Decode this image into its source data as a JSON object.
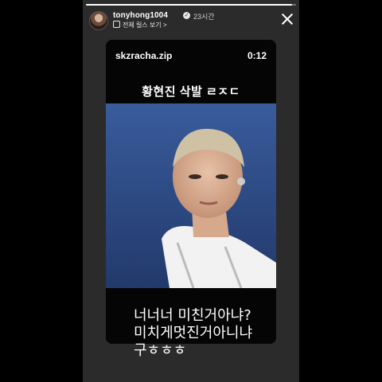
{
  "progress_fraction": 0.98,
  "header": {
    "username": "tonyhong1004",
    "time": "23시간",
    "reels_link": "전체 릴스 보기 >"
  },
  "card": {
    "title": "skzracha.zip",
    "timer": "0:12",
    "headline": "황현진 삭발 ㄹㅈㄷ"
  },
  "caption": "너너너 미친거아냐?\n미치게멋진거아니냐\n구ㅎㅎㅎ"
}
